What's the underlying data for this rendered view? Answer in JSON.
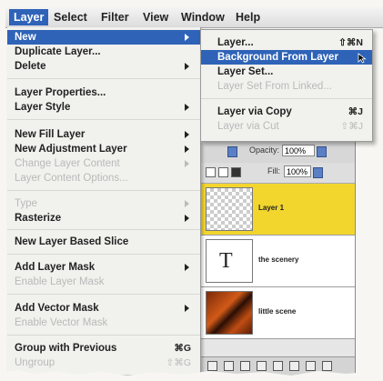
{
  "menubar": {
    "items": [
      "Layer",
      "Select",
      "Filter",
      "View",
      "Window",
      "Help"
    ]
  },
  "layer_menu": {
    "items": [
      {
        "label": "New",
        "submenu": true,
        "selected": true
      },
      {
        "label": "Duplicate Layer..."
      },
      {
        "label": "Delete",
        "submenu": true
      },
      {
        "label": "Layer Properties..."
      },
      {
        "label": "Layer Style",
        "submenu": true
      },
      {
        "label": "New Fill Layer",
        "submenu": true
      },
      {
        "label": "New Adjustment Layer",
        "submenu": true
      },
      {
        "label": "Change Layer Content",
        "submenu": true,
        "disabled": true
      },
      {
        "label": "Layer Content Options...",
        "disabled": true
      },
      {
        "label": "Type",
        "submenu": true,
        "disabled": true
      },
      {
        "label": "Rasterize",
        "submenu": true
      },
      {
        "label": "New Layer Based Slice"
      },
      {
        "label": "Add Layer Mask",
        "submenu": true
      },
      {
        "label": "Enable Layer Mask",
        "disabled": true
      },
      {
        "label": "Add Vector Mask",
        "submenu": true
      },
      {
        "label": "Enable Vector Mask",
        "disabled": true
      },
      {
        "label": "Group with Previous",
        "shortcut": "⌘G"
      },
      {
        "label": "Ungroup",
        "shortcut": "⇧⌘G",
        "disabled": true
      }
    ]
  },
  "new_submenu": {
    "items": [
      {
        "label": "Layer...",
        "shortcut": "⇧⌘N"
      },
      {
        "label": "Background From Layer",
        "selected": true
      },
      {
        "label": "Layer Set..."
      },
      {
        "label": "Layer Set From Linked...",
        "disabled": true
      },
      {
        "label": "Layer via Copy",
        "shortcut": "⌘J"
      },
      {
        "label": "Layer via Cut",
        "shortcut": "⇧⌘J",
        "disabled": true
      }
    ]
  },
  "layers_palette": {
    "opacity_label": "Opacity:",
    "opacity_value": "100%",
    "fill_label": "Fill:",
    "fill_value": "100%",
    "layers": [
      {
        "name": "Layer 1",
        "thumb": "checker",
        "active": true
      },
      {
        "name": "the scenery",
        "thumb": "text",
        "glyph": "T"
      },
      {
        "name": "little scene",
        "thumb": "photo"
      }
    ]
  },
  "colors": {
    "highlight": "#2e63b8",
    "active_layer": "#f2d62e"
  }
}
